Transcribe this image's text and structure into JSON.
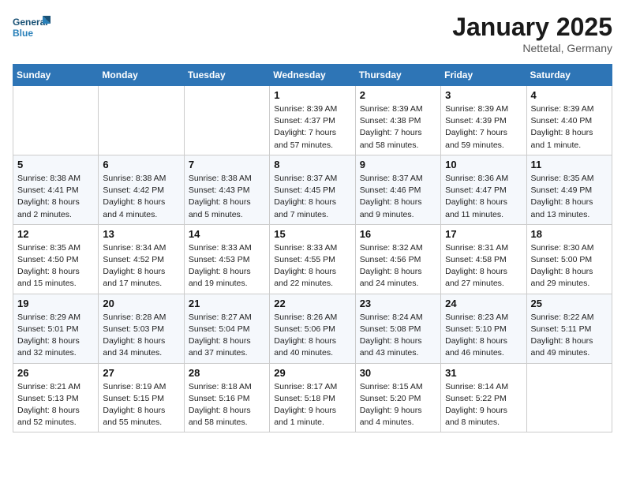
{
  "header": {
    "logo_line1": "General",
    "logo_line2": "Blue",
    "month_title": "January 2025",
    "location": "Nettetal, Germany"
  },
  "weekdays": [
    "Sunday",
    "Monday",
    "Tuesday",
    "Wednesday",
    "Thursday",
    "Friday",
    "Saturday"
  ],
  "weeks": [
    [
      {
        "day": "",
        "info": ""
      },
      {
        "day": "",
        "info": ""
      },
      {
        "day": "",
        "info": ""
      },
      {
        "day": "1",
        "info": "Sunrise: 8:39 AM\nSunset: 4:37 PM\nDaylight: 7 hours\nand 57 minutes."
      },
      {
        "day": "2",
        "info": "Sunrise: 8:39 AM\nSunset: 4:38 PM\nDaylight: 7 hours\nand 58 minutes."
      },
      {
        "day": "3",
        "info": "Sunrise: 8:39 AM\nSunset: 4:39 PM\nDaylight: 7 hours\nand 59 minutes."
      },
      {
        "day": "4",
        "info": "Sunrise: 8:39 AM\nSunset: 4:40 PM\nDaylight: 8 hours\nand 1 minute."
      }
    ],
    [
      {
        "day": "5",
        "info": "Sunrise: 8:38 AM\nSunset: 4:41 PM\nDaylight: 8 hours\nand 2 minutes."
      },
      {
        "day": "6",
        "info": "Sunrise: 8:38 AM\nSunset: 4:42 PM\nDaylight: 8 hours\nand 4 minutes."
      },
      {
        "day": "7",
        "info": "Sunrise: 8:38 AM\nSunset: 4:43 PM\nDaylight: 8 hours\nand 5 minutes."
      },
      {
        "day": "8",
        "info": "Sunrise: 8:37 AM\nSunset: 4:45 PM\nDaylight: 8 hours\nand 7 minutes."
      },
      {
        "day": "9",
        "info": "Sunrise: 8:37 AM\nSunset: 4:46 PM\nDaylight: 8 hours\nand 9 minutes."
      },
      {
        "day": "10",
        "info": "Sunrise: 8:36 AM\nSunset: 4:47 PM\nDaylight: 8 hours\nand 11 minutes."
      },
      {
        "day": "11",
        "info": "Sunrise: 8:35 AM\nSunset: 4:49 PM\nDaylight: 8 hours\nand 13 minutes."
      }
    ],
    [
      {
        "day": "12",
        "info": "Sunrise: 8:35 AM\nSunset: 4:50 PM\nDaylight: 8 hours\nand 15 minutes."
      },
      {
        "day": "13",
        "info": "Sunrise: 8:34 AM\nSunset: 4:52 PM\nDaylight: 8 hours\nand 17 minutes."
      },
      {
        "day": "14",
        "info": "Sunrise: 8:33 AM\nSunset: 4:53 PM\nDaylight: 8 hours\nand 19 minutes."
      },
      {
        "day": "15",
        "info": "Sunrise: 8:33 AM\nSunset: 4:55 PM\nDaylight: 8 hours\nand 22 minutes."
      },
      {
        "day": "16",
        "info": "Sunrise: 8:32 AM\nSunset: 4:56 PM\nDaylight: 8 hours\nand 24 minutes."
      },
      {
        "day": "17",
        "info": "Sunrise: 8:31 AM\nSunset: 4:58 PM\nDaylight: 8 hours\nand 27 minutes."
      },
      {
        "day": "18",
        "info": "Sunrise: 8:30 AM\nSunset: 5:00 PM\nDaylight: 8 hours\nand 29 minutes."
      }
    ],
    [
      {
        "day": "19",
        "info": "Sunrise: 8:29 AM\nSunset: 5:01 PM\nDaylight: 8 hours\nand 32 minutes."
      },
      {
        "day": "20",
        "info": "Sunrise: 8:28 AM\nSunset: 5:03 PM\nDaylight: 8 hours\nand 34 minutes."
      },
      {
        "day": "21",
        "info": "Sunrise: 8:27 AM\nSunset: 5:04 PM\nDaylight: 8 hours\nand 37 minutes."
      },
      {
        "day": "22",
        "info": "Sunrise: 8:26 AM\nSunset: 5:06 PM\nDaylight: 8 hours\nand 40 minutes."
      },
      {
        "day": "23",
        "info": "Sunrise: 8:24 AM\nSunset: 5:08 PM\nDaylight: 8 hours\nand 43 minutes."
      },
      {
        "day": "24",
        "info": "Sunrise: 8:23 AM\nSunset: 5:10 PM\nDaylight: 8 hours\nand 46 minutes."
      },
      {
        "day": "25",
        "info": "Sunrise: 8:22 AM\nSunset: 5:11 PM\nDaylight: 8 hours\nand 49 minutes."
      }
    ],
    [
      {
        "day": "26",
        "info": "Sunrise: 8:21 AM\nSunset: 5:13 PM\nDaylight: 8 hours\nand 52 minutes."
      },
      {
        "day": "27",
        "info": "Sunrise: 8:19 AM\nSunset: 5:15 PM\nDaylight: 8 hours\nand 55 minutes."
      },
      {
        "day": "28",
        "info": "Sunrise: 8:18 AM\nSunset: 5:16 PM\nDaylight: 8 hours\nand 58 minutes."
      },
      {
        "day": "29",
        "info": "Sunrise: 8:17 AM\nSunset: 5:18 PM\nDaylight: 9 hours\nand 1 minute."
      },
      {
        "day": "30",
        "info": "Sunrise: 8:15 AM\nSunset: 5:20 PM\nDaylight: 9 hours\nand 4 minutes."
      },
      {
        "day": "31",
        "info": "Sunrise: 8:14 AM\nSunset: 5:22 PM\nDaylight: 9 hours\nand 8 minutes."
      },
      {
        "day": "",
        "info": ""
      }
    ]
  ]
}
